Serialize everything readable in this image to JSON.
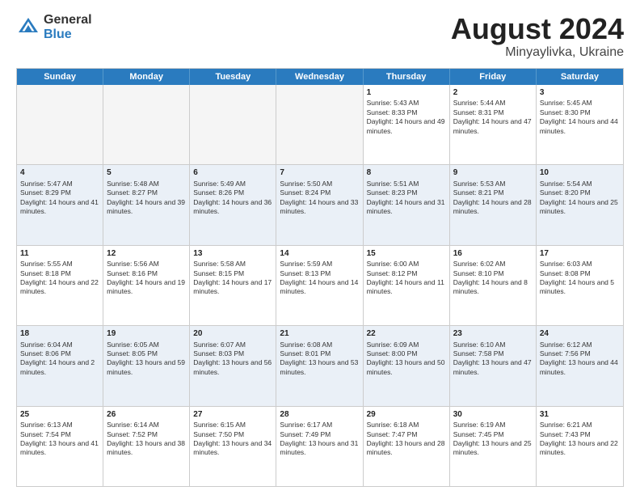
{
  "header": {
    "logo_line1": "General",
    "logo_line2": "Blue",
    "title": "August 2024",
    "location": "Minyaylivka, Ukraine"
  },
  "days_of_week": [
    "Sunday",
    "Monday",
    "Tuesday",
    "Wednesday",
    "Thursday",
    "Friday",
    "Saturday"
  ],
  "weeks": [
    [
      {
        "day": "",
        "sunrise": "",
        "sunset": "",
        "daylight": "",
        "empty": true
      },
      {
        "day": "",
        "sunrise": "",
        "sunset": "",
        "daylight": "",
        "empty": true
      },
      {
        "day": "",
        "sunrise": "",
        "sunset": "",
        "daylight": "",
        "empty": true
      },
      {
        "day": "",
        "sunrise": "",
        "sunset": "",
        "daylight": "",
        "empty": true
      },
      {
        "day": "1",
        "sunrise": "Sunrise: 5:43 AM",
        "sunset": "Sunset: 8:33 PM",
        "daylight": "Daylight: 14 hours and 49 minutes.",
        "empty": false
      },
      {
        "day": "2",
        "sunrise": "Sunrise: 5:44 AM",
        "sunset": "Sunset: 8:31 PM",
        "daylight": "Daylight: 14 hours and 47 minutes.",
        "empty": false
      },
      {
        "day": "3",
        "sunrise": "Sunrise: 5:45 AM",
        "sunset": "Sunset: 8:30 PM",
        "daylight": "Daylight: 14 hours and 44 minutes.",
        "empty": false
      }
    ],
    [
      {
        "day": "4",
        "sunrise": "Sunrise: 5:47 AM",
        "sunset": "Sunset: 8:29 PM",
        "daylight": "Daylight: 14 hours and 41 minutes.",
        "empty": false
      },
      {
        "day": "5",
        "sunrise": "Sunrise: 5:48 AM",
        "sunset": "Sunset: 8:27 PM",
        "daylight": "Daylight: 14 hours and 39 minutes.",
        "empty": false
      },
      {
        "day": "6",
        "sunrise": "Sunrise: 5:49 AM",
        "sunset": "Sunset: 8:26 PM",
        "daylight": "Daylight: 14 hours and 36 minutes.",
        "empty": false
      },
      {
        "day": "7",
        "sunrise": "Sunrise: 5:50 AM",
        "sunset": "Sunset: 8:24 PM",
        "daylight": "Daylight: 14 hours and 33 minutes.",
        "empty": false
      },
      {
        "day": "8",
        "sunrise": "Sunrise: 5:51 AM",
        "sunset": "Sunset: 8:23 PM",
        "daylight": "Daylight: 14 hours and 31 minutes.",
        "empty": false
      },
      {
        "day": "9",
        "sunrise": "Sunrise: 5:53 AM",
        "sunset": "Sunset: 8:21 PM",
        "daylight": "Daylight: 14 hours and 28 minutes.",
        "empty": false
      },
      {
        "day": "10",
        "sunrise": "Sunrise: 5:54 AM",
        "sunset": "Sunset: 8:20 PM",
        "daylight": "Daylight: 14 hours and 25 minutes.",
        "empty": false
      }
    ],
    [
      {
        "day": "11",
        "sunrise": "Sunrise: 5:55 AM",
        "sunset": "Sunset: 8:18 PM",
        "daylight": "Daylight: 14 hours and 22 minutes.",
        "empty": false
      },
      {
        "day": "12",
        "sunrise": "Sunrise: 5:56 AM",
        "sunset": "Sunset: 8:16 PM",
        "daylight": "Daylight: 14 hours and 19 minutes.",
        "empty": false
      },
      {
        "day": "13",
        "sunrise": "Sunrise: 5:58 AM",
        "sunset": "Sunset: 8:15 PM",
        "daylight": "Daylight: 14 hours and 17 minutes.",
        "empty": false
      },
      {
        "day": "14",
        "sunrise": "Sunrise: 5:59 AM",
        "sunset": "Sunset: 8:13 PM",
        "daylight": "Daylight: 14 hours and 14 minutes.",
        "empty": false
      },
      {
        "day": "15",
        "sunrise": "Sunrise: 6:00 AM",
        "sunset": "Sunset: 8:12 PM",
        "daylight": "Daylight: 14 hours and 11 minutes.",
        "empty": false
      },
      {
        "day": "16",
        "sunrise": "Sunrise: 6:02 AM",
        "sunset": "Sunset: 8:10 PM",
        "daylight": "Daylight: 14 hours and 8 minutes.",
        "empty": false
      },
      {
        "day": "17",
        "sunrise": "Sunrise: 6:03 AM",
        "sunset": "Sunset: 8:08 PM",
        "daylight": "Daylight: 14 hours and 5 minutes.",
        "empty": false
      }
    ],
    [
      {
        "day": "18",
        "sunrise": "Sunrise: 6:04 AM",
        "sunset": "Sunset: 8:06 PM",
        "daylight": "Daylight: 14 hours and 2 minutes.",
        "empty": false
      },
      {
        "day": "19",
        "sunrise": "Sunrise: 6:05 AM",
        "sunset": "Sunset: 8:05 PM",
        "daylight": "Daylight: 13 hours and 59 minutes.",
        "empty": false
      },
      {
        "day": "20",
        "sunrise": "Sunrise: 6:07 AM",
        "sunset": "Sunset: 8:03 PM",
        "daylight": "Daylight: 13 hours and 56 minutes.",
        "empty": false
      },
      {
        "day": "21",
        "sunrise": "Sunrise: 6:08 AM",
        "sunset": "Sunset: 8:01 PM",
        "daylight": "Daylight: 13 hours and 53 minutes.",
        "empty": false
      },
      {
        "day": "22",
        "sunrise": "Sunrise: 6:09 AM",
        "sunset": "Sunset: 8:00 PM",
        "daylight": "Daylight: 13 hours and 50 minutes.",
        "empty": false
      },
      {
        "day": "23",
        "sunrise": "Sunrise: 6:10 AM",
        "sunset": "Sunset: 7:58 PM",
        "daylight": "Daylight: 13 hours and 47 minutes.",
        "empty": false
      },
      {
        "day": "24",
        "sunrise": "Sunrise: 6:12 AM",
        "sunset": "Sunset: 7:56 PM",
        "daylight": "Daylight: 13 hours and 44 minutes.",
        "empty": false
      }
    ],
    [
      {
        "day": "25",
        "sunrise": "Sunrise: 6:13 AM",
        "sunset": "Sunset: 7:54 PM",
        "daylight": "Daylight: 13 hours and 41 minutes.",
        "empty": false
      },
      {
        "day": "26",
        "sunrise": "Sunrise: 6:14 AM",
        "sunset": "Sunset: 7:52 PM",
        "daylight": "Daylight: 13 hours and 38 minutes.",
        "empty": false
      },
      {
        "day": "27",
        "sunrise": "Sunrise: 6:15 AM",
        "sunset": "Sunset: 7:50 PM",
        "daylight": "Daylight: 13 hours and 34 minutes.",
        "empty": false
      },
      {
        "day": "28",
        "sunrise": "Sunrise: 6:17 AM",
        "sunset": "Sunset: 7:49 PM",
        "daylight": "Daylight: 13 hours and 31 minutes.",
        "empty": false
      },
      {
        "day": "29",
        "sunrise": "Sunrise: 6:18 AM",
        "sunset": "Sunset: 7:47 PM",
        "daylight": "Daylight: 13 hours and 28 minutes.",
        "empty": false
      },
      {
        "day": "30",
        "sunrise": "Sunrise: 6:19 AM",
        "sunset": "Sunset: 7:45 PM",
        "daylight": "Daylight: 13 hours and 25 minutes.",
        "empty": false
      },
      {
        "day": "31",
        "sunrise": "Sunrise: 6:21 AM",
        "sunset": "Sunset: 7:43 PM",
        "daylight": "Daylight: 13 hours and 22 minutes.",
        "empty": false
      }
    ]
  ]
}
